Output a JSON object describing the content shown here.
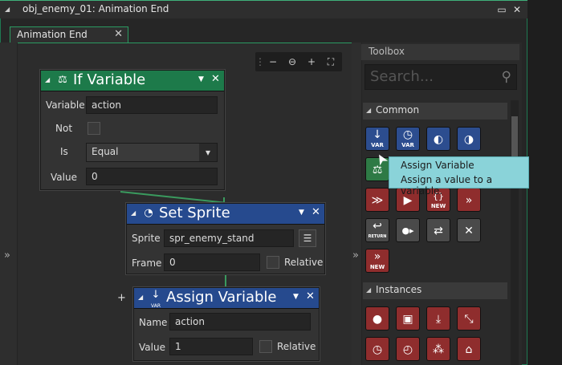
{
  "window": {
    "title": "obj_enemy_01: Animation End",
    "collapse_glyph": "◢",
    "min_glyph": "▭",
    "close_glyph": "✕"
  },
  "tab": {
    "label": "Animation End",
    "close_glyph": "✕"
  },
  "canvas": {
    "expand_glyph": "»",
    "zoom": {
      "grip": "⋮",
      "zoom_out": "−",
      "zoom_reset": "⊖",
      "zoom_in": "+",
      "fit": "⛶"
    }
  },
  "nodes": {
    "if_variable": {
      "title": "If Variable",
      "icon": "⚖",
      "arrow": "◢",
      "menu": "▼",
      "close": "✕",
      "variable_label": "Variable",
      "variable_value": "action",
      "not_label": "Not",
      "is_label": "Is",
      "is_value": "Equal",
      "is_dropdown": "▾",
      "value_label": "Value",
      "value_value": "0"
    },
    "set_sprite": {
      "title": "Set Sprite",
      "icon": "◔",
      "arrow": "◢",
      "menu": "▼",
      "close": "✕",
      "sprite_label": "Sprite",
      "sprite_value": "spr_enemy_stand",
      "frame_label": "Frame",
      "frame_value": "0",
      "relative_label": "Relative",
      "picker_glyph": "☰"
    },
    "assign_variable": {
      "title": "Assign Variable",
      "icon": "↓",
      "icon_sub": "VAR",
      "arrow": "◢",
      "menu": "▼",
      "close": "✕",
      "add_glyph": "+",
      "name_label": "Name",
      "name_value": "action",
      "value_label": "Value",
      "value_value": "1",
      "relative_label": "Relative"
    }
  },
  "toolbox": {
    "expand_glyph": "»",
    "title": "Toolbox",
    "search_placeholder": "Search...",
    "search_icon": "⚲",
    "sections": [
      {
        "arrow": "◢",
        "label": "Common"
      },
      {
        "arrow": "◢",
        "label": "Instances"
      }
    ],
    "common_buttons": [
      {
        "glyph": "↓",
        "sub": "VAR",
        "icon": "assign-variable-icon"
      },
      {
        "glyph": "◷",
        "sub": "VAR",
        "icon": "declare-temp-icon"
      },
      {
        "glyph": "◐",
        "sub": "",
        "icon": "get-global-icon"
      },
      {
        "glyph": "◑",
        "sub": "",
        "icon": "set-global-icon"
      },
      {
        "glyph": "⚖",
        "sub": "",
        "icon": "if-variable-icon"
      },
      {
        "glyph": "≫",
        "sub": "",
        "icon": "execute-code-icon"
      },
      {
        "glyph": "▶",
        "sub": "",
        "icon": "function-call-icon"
      },
      {
        "glyph": "{}",
        "sub": "NEW",
        "icon": "declare-function-icon"
      },
      {
        "glyph": "»",
        "sub": "",
        "icon": "next-icon"
      },
      {
        "glyph": "↩",
        "sub": "RETURN",
        "icon": "return-icon"
      },
      {
        "glyph": "●▸",
        "sub": "",
        "icon": "exit-event-icon"
      },
      {
        "glyph": "⇄",
        "sub": "",
        "icon": "swap-icon"
      },
      {
        "glyph": "✕",
        "sub": "",
        "icon": "break-icon"
      },
      {
        "glyph": "»",
        "sub": "NEW",
        "icon": "new-icon"
      }
    ],
    "instance_buttons": [
      {
        "glyph": "●",
        "icon": "create-instance-icon"
      },
      {
        "glyph": "▣",
        "icon": "destroy-instance-icon"
      },
      {
        "glyph": "⤓",
        "icon": "instance-exists-icon"
      },
      {
        "glyph": "⤡",
        "icon": "change-instance-icon"
      },
      {
        "glyph": "◷",
        "icon": "alarm-icon"
      },
      {
        "glyph": "◴",
        "icon": "set-alarm-icon"
      },
      {
        "glyph": "⁂",
        "icon": "instance-count-icon"
      },
      {
        "glyph": "⌂",
        "icon": "instance-var-icon"
      }
    ]
  },
  "tooltip": {
    "title": "Assign Variable",
    "description": "Assign a value to a variable."
  },
  "cursor": "➤"
}
